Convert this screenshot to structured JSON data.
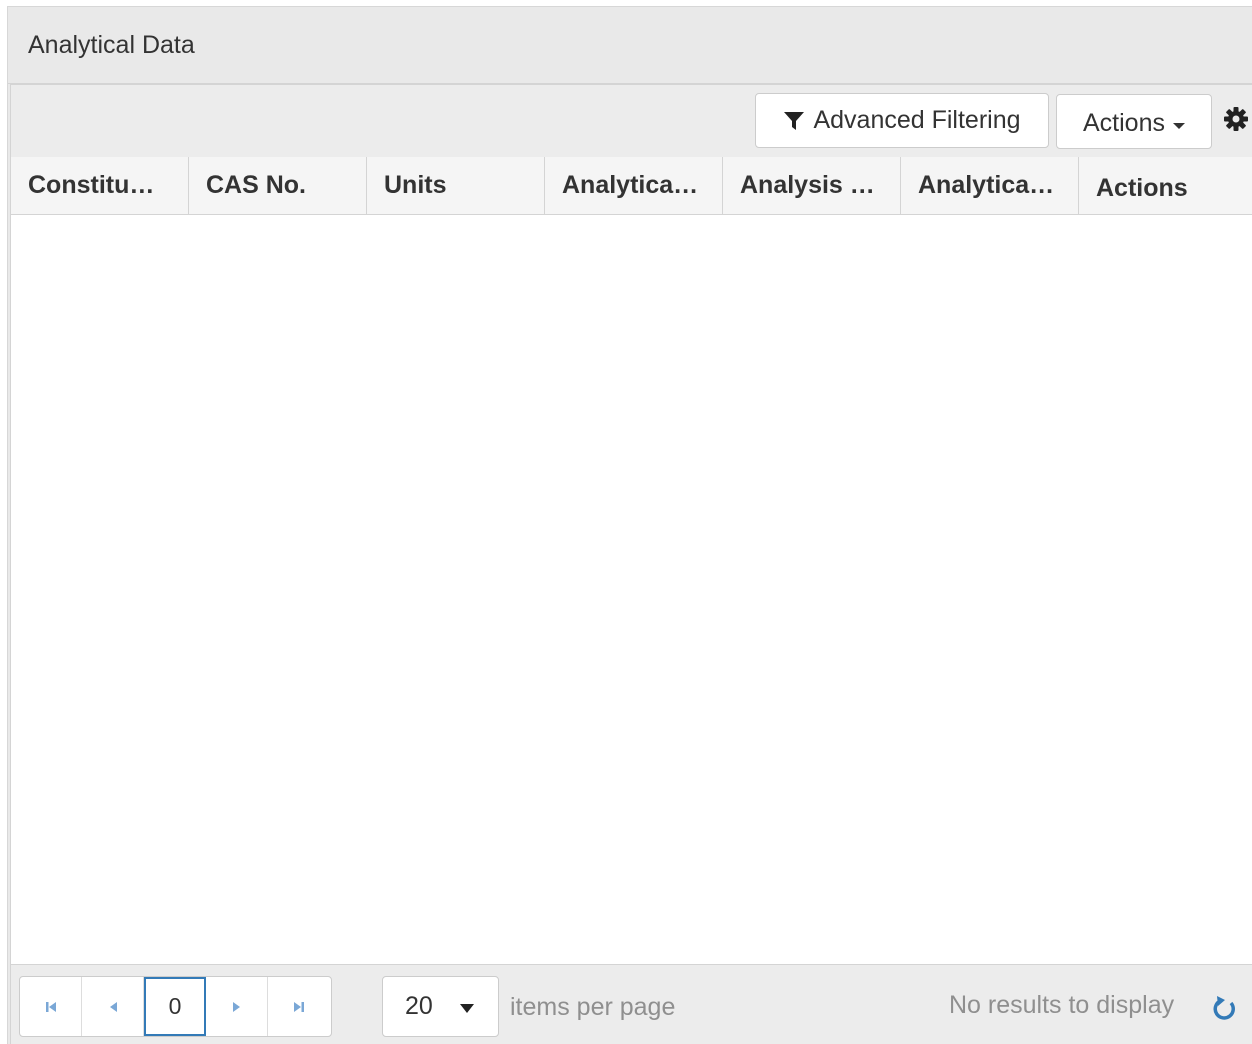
{
  "panel": {
    "title": "Analytical Data"
  },
  "toolbar": {
    "advanced_filtering": "Advanced Filtering",
    "actions": "Actions",
    "settings_icon": "gear-icon",
    "filter_icon": "filter-icon"
  },
  "columns": [
    "Constitu…",
    "CAS No.",
    "Units",
    "Analytica…",
    "Analysis …",
    "Analytica…",
    "Actions"
  ],
  "pager": {
    "current_page": "0",
    "page_size": "20",
    "items_per_page_label": "items per page",
    "status": "No results to display"
  },
  "colors": {
    "accent": "#337ab7",
    "muted_text": "#8f8f8f"
  }
}
